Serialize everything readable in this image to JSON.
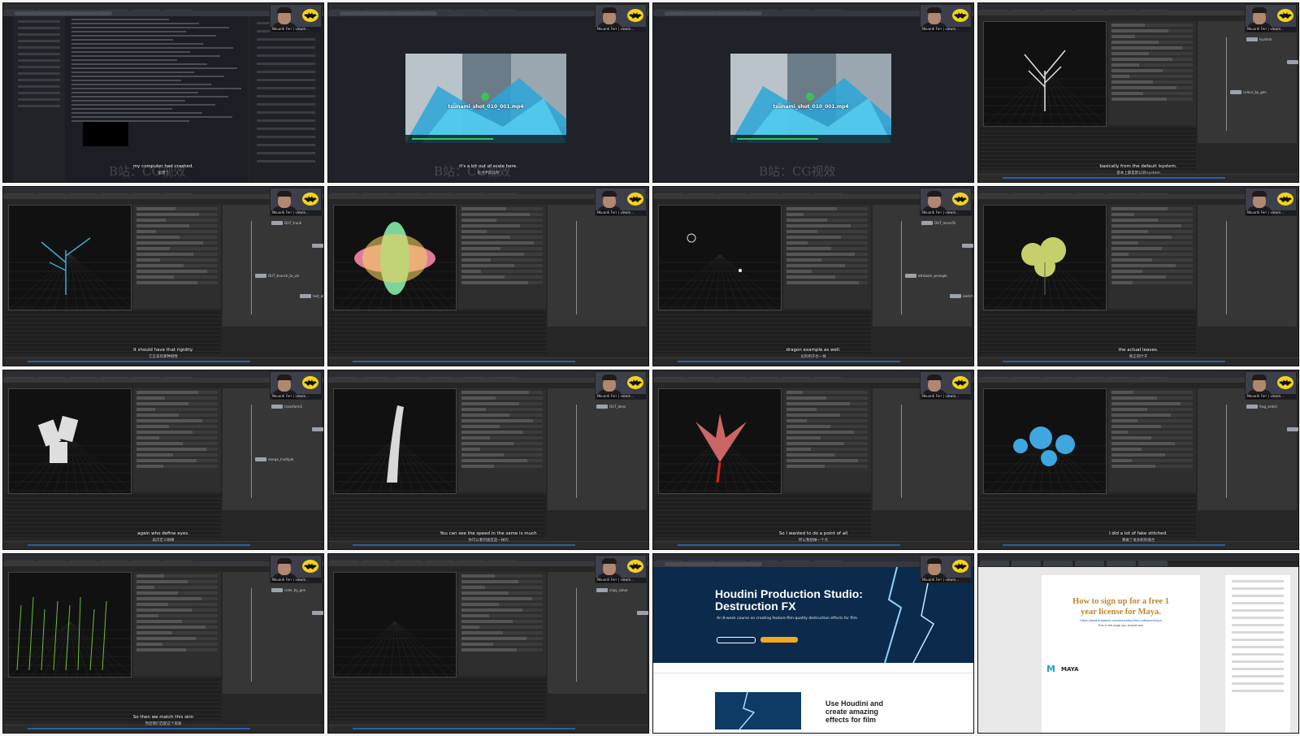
{
  "streamer_label": "Nkuardi Ferr | viewin...",
  "watermark_text": "B站：CG视效",
  "tiles": [
    {
      "kind": "chat",
      "sub_en": "my computer had crashed.",
      "sub_cn": "崩溃了"
    },
    {
      "kind": "video",
      "video_title": "tsunami_shot_010_001.mp4",
      "sub_en": "it's a bit out of scale here.",
      "sub_cn": "有点不成比例"
    },
    {
      "kind": "video",
      "video_title": "tsunami_shot_010_001.mp4",
      "sub_en": "",
      "sub_cn": ""
    },
    {
      "kind": "houdini",
      "sub_en": "basically from the default lsystem.",
      "sub_cn": "基本上都是默认的lsystem",
      "nodes": [
        "lsystem",
        "lsystem1",
        "colour_by_gen"
      ]
    },
    {
      "kind": "houdini",
      "sub_en": "It should have that rigidity.",
      "sub_cn": "它应该有那种刚性",
      "nodes": [
        "OUT_trunk",
        "get_leaves",
        "OUT_branch_to_vin",
        "test_attr"
      ]
    },
    {
      "kind": "houdini",
      "sub_en": "",
      "sub_cn": "",
      "nodes": []
    },
    {
      "kind": "houdini",
      "sub_en": "dragon example as well.",
      "sub_cn": "龙的例子也一样",
      "nodes": [
        "OUT_moveTo",
        "stitch_mesphere",
        "attribute_wrangle",
        "switch1"
      ]
    },
    {
      "kind": "houdini",
      "sub_en": "the actual leaves.",
      "sub_cn": "真正的叶子",
      "nodes": []
    },
    {
      "kind": "houdini",
      "sub_en": "again who define eyes.",
      "sub_cn": "再次定义眼睛",
      "nodes": [
        "transform1",
        "split1",
        "merge_multiple"
      ]
    },
    {
      "kind": "houdini",
      "sub_en": "You can see the speed in the same is much",
      "sub_cn": "你可以看到速度是一样的",
      "nodes": [
        "OUT_dens"
      ]
    },
    {
      "kind": "houdini",
      "sub_en": "So I wanted to do a point of all",
      "sub_cn": "所以我想做一个点",
      "nodes": []
    },
    {
      "kind": "houdini",
      "sub_en": "I did a lot of fake stitched.",
      "sub_cn": "我做了很多假的缝合",
      "nodes": [
        "frag_select",
        "alfa"
      ]
    },
    {
      "kind": "houdini",
      "sub_en": "So then we match this skin",
      "sub_cn": "然后我们匹配这个皮肤",
      "nodes": [
        "color_by_gen",
        "rotate_by_gen"
      ]
    },
    {
      "kind": "houdini",
      "sub_en": "",
      "sub_cn": "",
      "nodes": [
        "copy_value",
        "mask"
      ]
    },
    {
      "kind": "site",
      "hero_title_1": "Houdini Production Studio:",
      "hero_title_2": "Destruction FX",
      "hero_sub": "An 8-week course on creating feature-film-quality destruction effects for film",
      "card_h1": "Use Houdini and",
      "card_h2": "create amazing",
      "card_h3": "effects for film"
    },
    {
      "kind": "pdf",
      "title1": "How to sign up for a free 1",
      "title2": "year license for Maya.",
      "line1": "This is the page you should see.",
      "link": "https://www.autodesk.com/education/free-software/maya",
      "brand": "MAYA"
    }
  ],
  "colors": {
    "accent": "#2c5ea8",
    "play": "#3fbf5a",
    "hero": "#0c2a4b",
    "maya_title": "#c4852b"
  }
}
